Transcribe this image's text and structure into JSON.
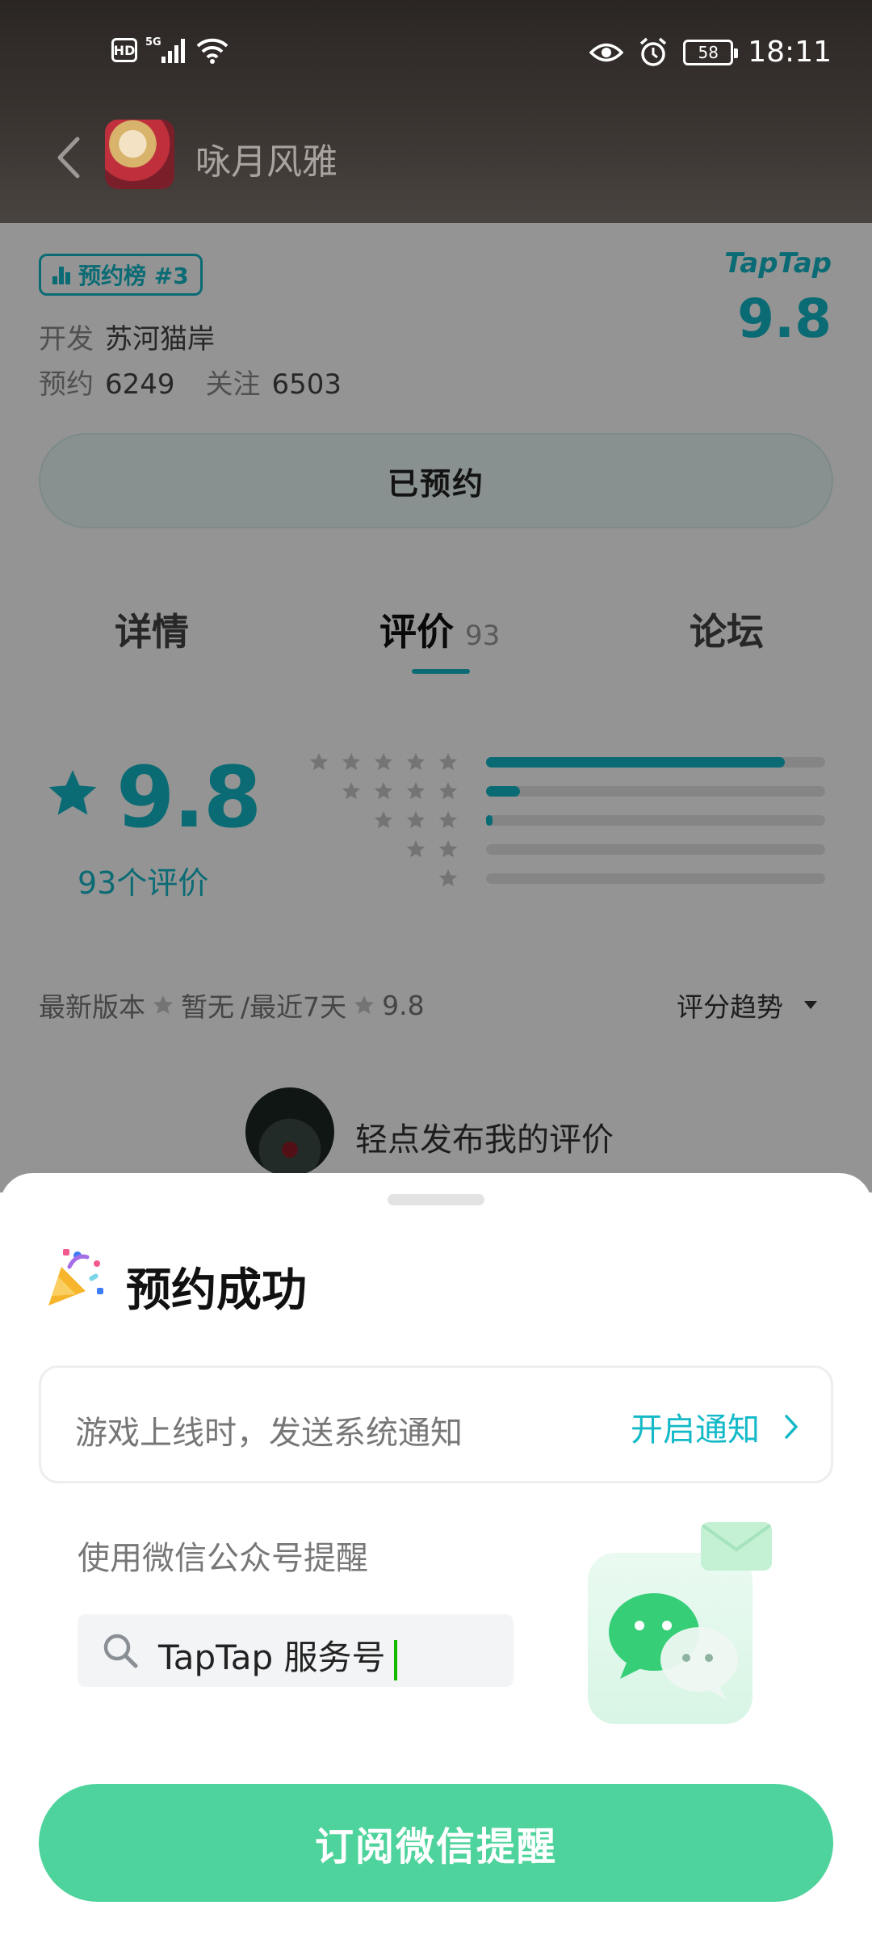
{
  "status_bar": {
    "hd": "HD",
    "network": "5G",
    "battery": "58",
    "time": "18:11"
  },
  "nav": {
    "title": "咏月风雅"
  },
  "game": {
    "rank_badge": "预约榜 #3",
    "taptap_logo": "TapTap",
    "taptap_score": "9.8",
    "developer_label": "开发",
    "developer": "苏河猫岸",
    "reserve_label": "预约",
    "reserve_count": "6249",
    "follow_label": "关注",
    "follow_count": "6503",
    "reserved_button": "已预约"
  },
  "tabs": [
    {
      "label": "详情"
    },
    {
      "label": "评价",
      "count": "93"
    },
    {
      "label": "论坛"
    }
  ],
  "rating": {
    "score": "9.8",
    "count_text": "93个评价",
    "distribution": [
      {
        "stars": 5,
        "fraction": 0.88
      },
      {
        "stars": 4,
        "fraction": 0.1
      },
      {
        "stars": 3,
        "fraction": 0.02
      },
      {
        "stars": 2,
        "fraction": 0.0
      },
      {
        "stars": 1,
        "fraction": 0.0
      }
    ],
    "latest_version_label": "最新版本",
    "latest_version_value": "暂无",
    "recent_label": "/最近7天",
    "recent_value": "9.8",
    "trend_label": "评分趋势"
  },
  "post_review": {
    "text": "轻点发布我的评价"
  },
  "sheet": {
    "title": "预约成功",
    "notify_text": "游戏上线时，发送系统通知",
    "notify_link": "开启通知",
    "wechat_label": "使用微信公众号提醒",
    "search_text": "TapTap 服务号",
    "subscribe_button": "订阅微信提醒"
  },
  "colors": {
    "accent": "#14b9c8",
    "primary_button": "#4fd39c"
  }
}
